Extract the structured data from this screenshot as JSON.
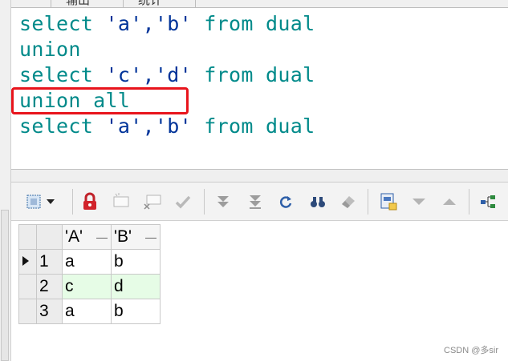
{
  "tabs": [
    "",
    "输出",
    "统计"
  ],
  "editor": {
    "lines": [
      {
        "kw1": "select ",
        "str": "'a','b'",
        "kw2": " from dual"
      },
      {
        "kw1": "union",
        "str": "",
        "kw2": ""
      },
      {
        "kw1": "select ",
        "str": "'c','d'",
        "kw2": " from dual"
      },
      {
        "kw1": "union all",
        "str": "",
        "kw2": ""
      },
      {
        "kw1": "select ",
        "str": "'a','b'",
        "kw2": " from dual"
      }
    ],
    "highlight_color": "#e8141c"
  },
  "toolbar": {
    "icons": [
      "select-grid-icon",
      "dropdown-arrow-icon",
      "lock-icon",
      "insert-record-icon",
      "delete-record-icon",
      "post-checkmark-icon",
      "fetch-next-icon",
      "fetch-all-icon",
      "refresh-icon",
      "find-icon",
      "clear-eraser-icon",
      "export-icon",
      "move-down-icon",
      "move-up-icon",
      "tree-view-icon"
    ]
  },
  "grid": {
    "columns": [
      "'A'",
      "'B'"
    ],
    "rows": [
      {
        "num": "1",
        "A": "a",
        "B": "b",
        "current": true
      },
      {
        "num": "2",
        "A": "c",
        "B": "d",
        "current": false
      },
      {
        "num": "3",
        "A": "a",
        "B": "b",
        "current": false
      }
    ]
  },
  "watermark": "CSDN @多sir"
}
